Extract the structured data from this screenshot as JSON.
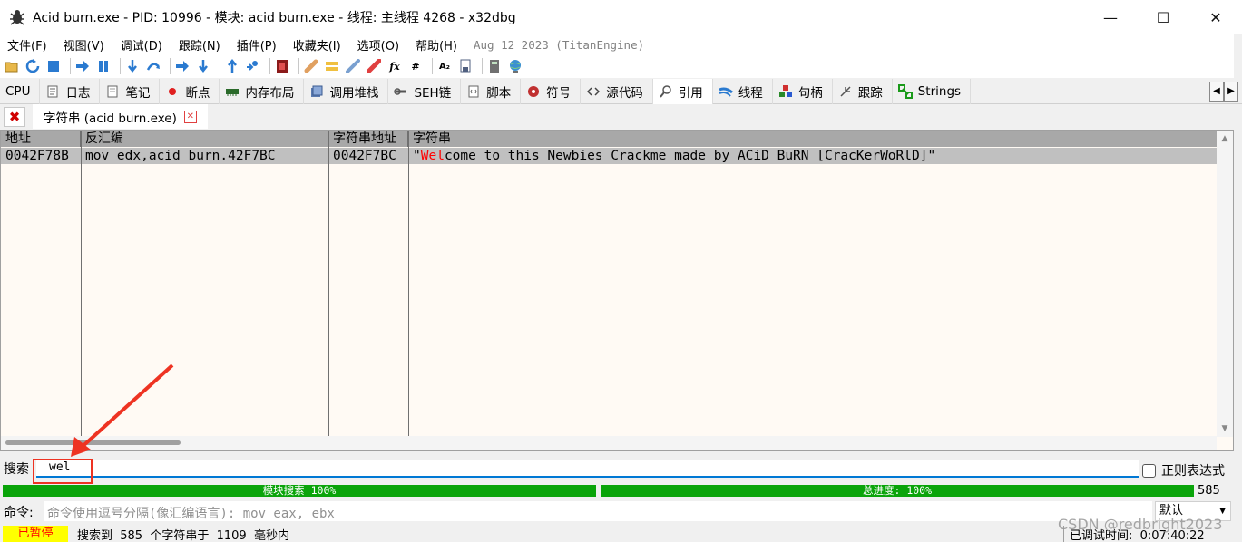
{
  "window": {
    "title": "Acid burn.exe - PID: 10996 - 模块: acid burn.exe - 线程: 主线程 4268 - x32dbg",
    "minimize": "—",
    "maximize": "☐",
    "close": "✕"
  },
  "menu": {
    "items": [
      "文件(F)",
      "视图(V)",
      "调试(D)",
      "跟踪(N)",
      "插件(P)",
      "收藏夹(I)",
      "选项(O)",
      "帮助(H)"
    ],
    "build_date": "Aug 12 2023 (TitanEngine)"
  },
  "toolbar": {
    "fx": "fx",
    "hash": "#",
    "az": "A₂"
  },
  "tabs": [
    {
      "label": "CPU",
      "icon": ""
    },
    {
      "label": "日志",
      "icon": "log-icon"
    },
    {
      "label": "笔记",
      "icon": "notes-icon"
    },
    {
      "label": "断点",
      "icon": "breakpoint-icon"
    },
    {
      "label": "内存布局",
      "icon": "memory-icon"
    },
    {
      "label": "调用堆栈",
      "icon": "callstack-icon"
    },
    {
      "label": "SEH链",
      "icon": "seh-icon"
    },
    {
      "label": "脚本",
      "icon": "script-icon"
    },
    {
      "label": "符号",
      "icon": "symbols-icon"
    },
    {
      "label": "源代码",
      "icon": "source-icon"
    },
    {
      "label": "引用",
      "icon": "references-icon"
    },
    {
      "label": "线程",
      "icon": "threads-icon"
    },
    {
      "label": "句柄",
      "icon": "handles-icon"
    },
    {
      "label": "跟踪",
      "icon": "trace-icon"
    },
    {
      "label": "Strings",
      "icon": "strings-icon"
    }
  ],
  "subtab": {
    "label": "字符串 (acid burn.exe)"
  },
  "table": {
    "headers": [
      "地址",
      "反汇编",
      "字符串地址",
      "字符串"
    ],
    "row": {
      "address": "0042F78B",
      "disasm": "mov edx,acid burn.42F7BC",
      "string_address": "0042F7BC",
      "string_quote_open": "\"",
      "string_match": "Wel",
      "string_rest": "come to this Newbies Crackme made by ACiD BuRN [CracKerWoRlD]\""
    }
  },
  "search": {
    "label": "搜索",
    "value": "wel",
    "regex_label": "正则表达式"
  },
  "progress": {
    "module_label": "模块搜索 100%",
    "module_fraction": 1.0,
    "total_label": "总进度: 100%",
    "total_fraction": 1.0,
    "count": "585"
  },
  "command": {
    "label": "命令:",
    "placeholder": "命令使用逗号分隔(像汇编语言): mov eax, ebx",
    "mode": "默认"
  },
  "status": {
    "state": "已暂停",
    "message": "搜索到  585  个字符串于  1109  毫秒内",
    "debug_time": "已调试时间:  0:07:40:22"
  },
  "watermark": "CSDN @redbright2023",
  "colors": {
    "progress": "#0aa40a",
    "paused_bg": "#ffff00",
    "paused_text": "#ff0000",
    "match": "#ff0000",
    "annotation": "#ee3322"
  }
}
